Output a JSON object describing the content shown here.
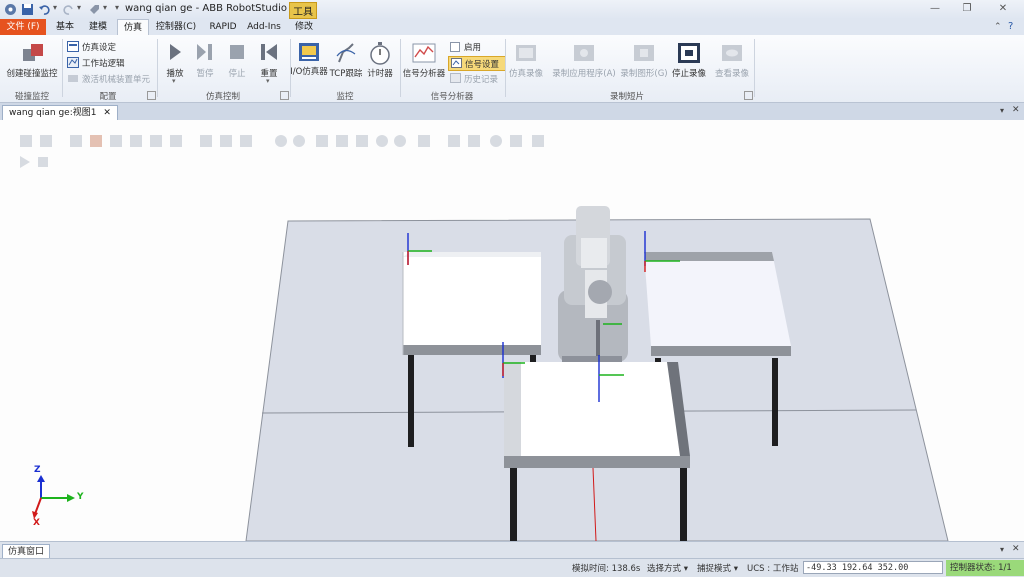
{
  "window": {
    "title": "wang qian ge - ABB RobotStudio ...",
    "context_badge": "工具"
  },
  "tabs": [
    "文件 (F)",
    "基本",
    "建模",
    "仿真",
    "控制器(C)",
    "RAPID",
    "Add-Ins",
    "修改"
  ],
  "active_tab": "仿真",
  "ribbon": {
    "collision": {
      "button": "创建碰撞监控",
      "group": "碰撞监控"
    },
    "config": {
      "items": [
        "仿真设定",
        "工作站逻辑",
        "激活机械装置单元"
      ],
      "group": "配置"
    },
    "sim_control": {
      "buttons": [
        "播放",
        "暂停",
        "停止",
        "重置"
      ],
      "group": "仿真控制"
    },
    "monitor": {
      "buttons": [
        "I/O仿真器",
        "TCP跟踪",
        "计时器"
      ],
      "group": "监控"
    },
    "signal": {
      "button": "信号分析器",
      "items": [
        "启用",
        "信号设置",
        "历史记录"
      ],
      "group": "信号分析器"
    },
    "record": {
      "buttons": [
        "仿真录像",
        "录制应用程序(A)",
        "录制图形(G)",
        "停止录像",
        "查看录像"
      ],
      "group": "录制短片"
    }
  },
  "document": {
    "tab_title": "wang qian ge:视图1"
  },
  "axes": {
    "x": "X",
    "y": "Y",
    "z": "Z"
  },
  "output": {
    "tab_title": "仿真窗口"
  },
  "status": {
    "sim_time": "模拟时间: 138.6s",
    "select_mode": "选择方式",
    "snap_mode": "捕捉模式",
    "ucs": "UCS : 工作站",
    "coords": "-49.33   192.64   352.00",
    "controller_status": "控制器状态: 1/1"
  },
  "colors": {
    "file_tab": "#e6531f",
    "controller_ok": "#9ad97a",
    "axis_x": "#d11a1a",
    "axis_y": "#1db31d",
    "axis_z": "#1a2fd1"
  }
}
